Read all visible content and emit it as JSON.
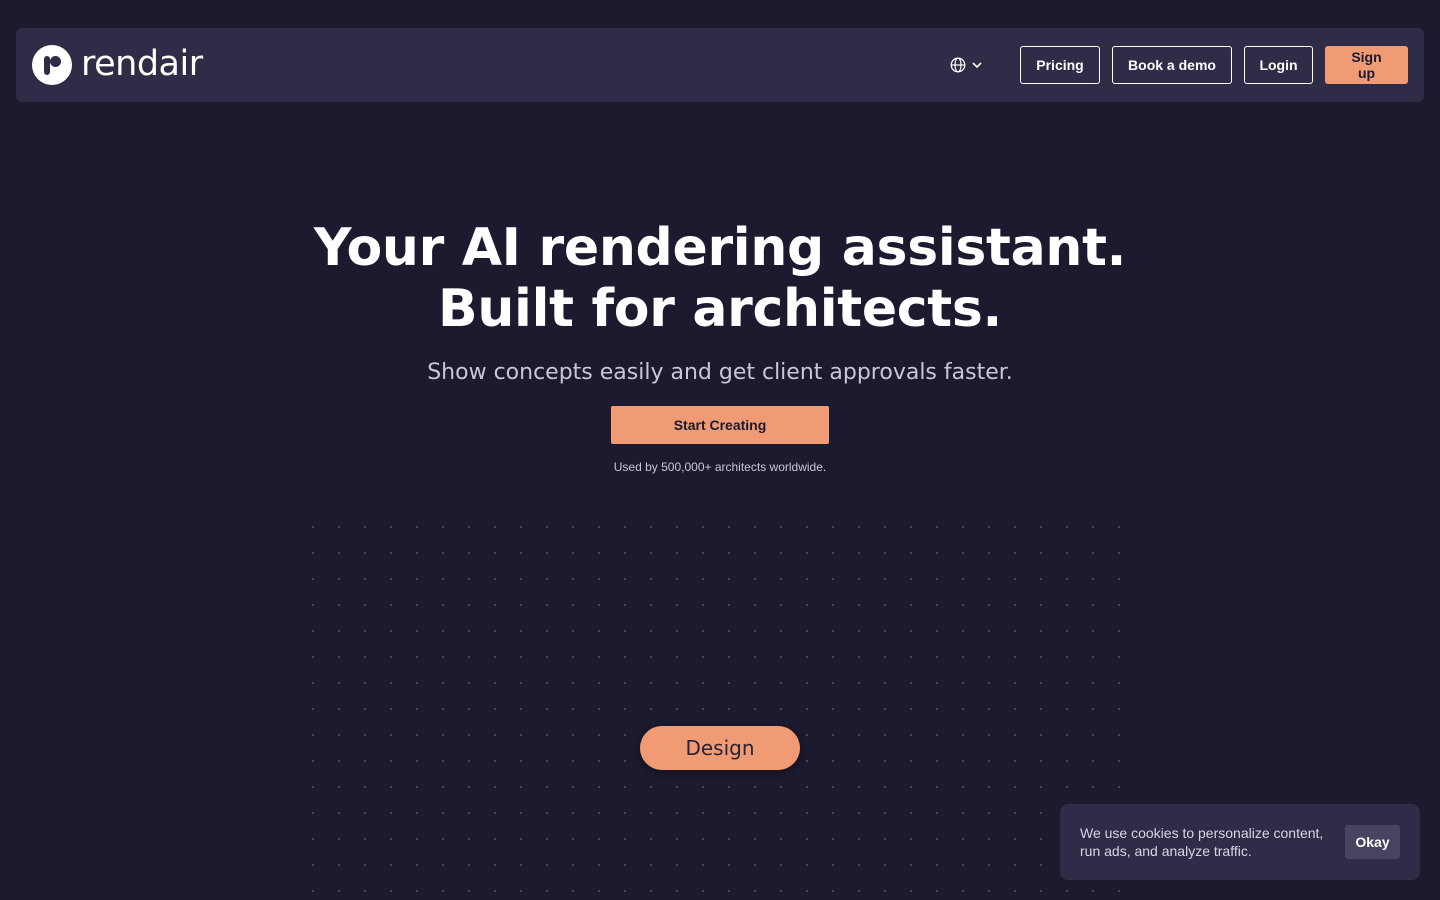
{
  "brand": {
    "name": "rendair",
    "accent_color": "#f09b74",
    "background_color": "#1b1a2e",
    "panel_color": "#2e2c47"
  },
  "nav": {
    "language_icon": "globe-icon",
    "pricing_label": "Pricing",
    "book_demo_label": "Book a demo",
    "login_label": "Login",
    "signup_label": "Sign up"
  },
  "hero": {
    "title_line1": "Your AI rendering assistant.",
    "title_line2": "Built for architects.",
    "subtitle": "Show concepts easily and get client approvals faster.",
    "cta_label": "Start Creating",
    "social_proof": "Used by 500,000+ architects worldwide."
  },
  "canvas": {
    "pill_label": "Design"
  },
  "cookie_banner": {
    "text": "We use cookies to personalize content, run ads, and analyze traffic.",
    "ok_label": "Okay"
  }
}
